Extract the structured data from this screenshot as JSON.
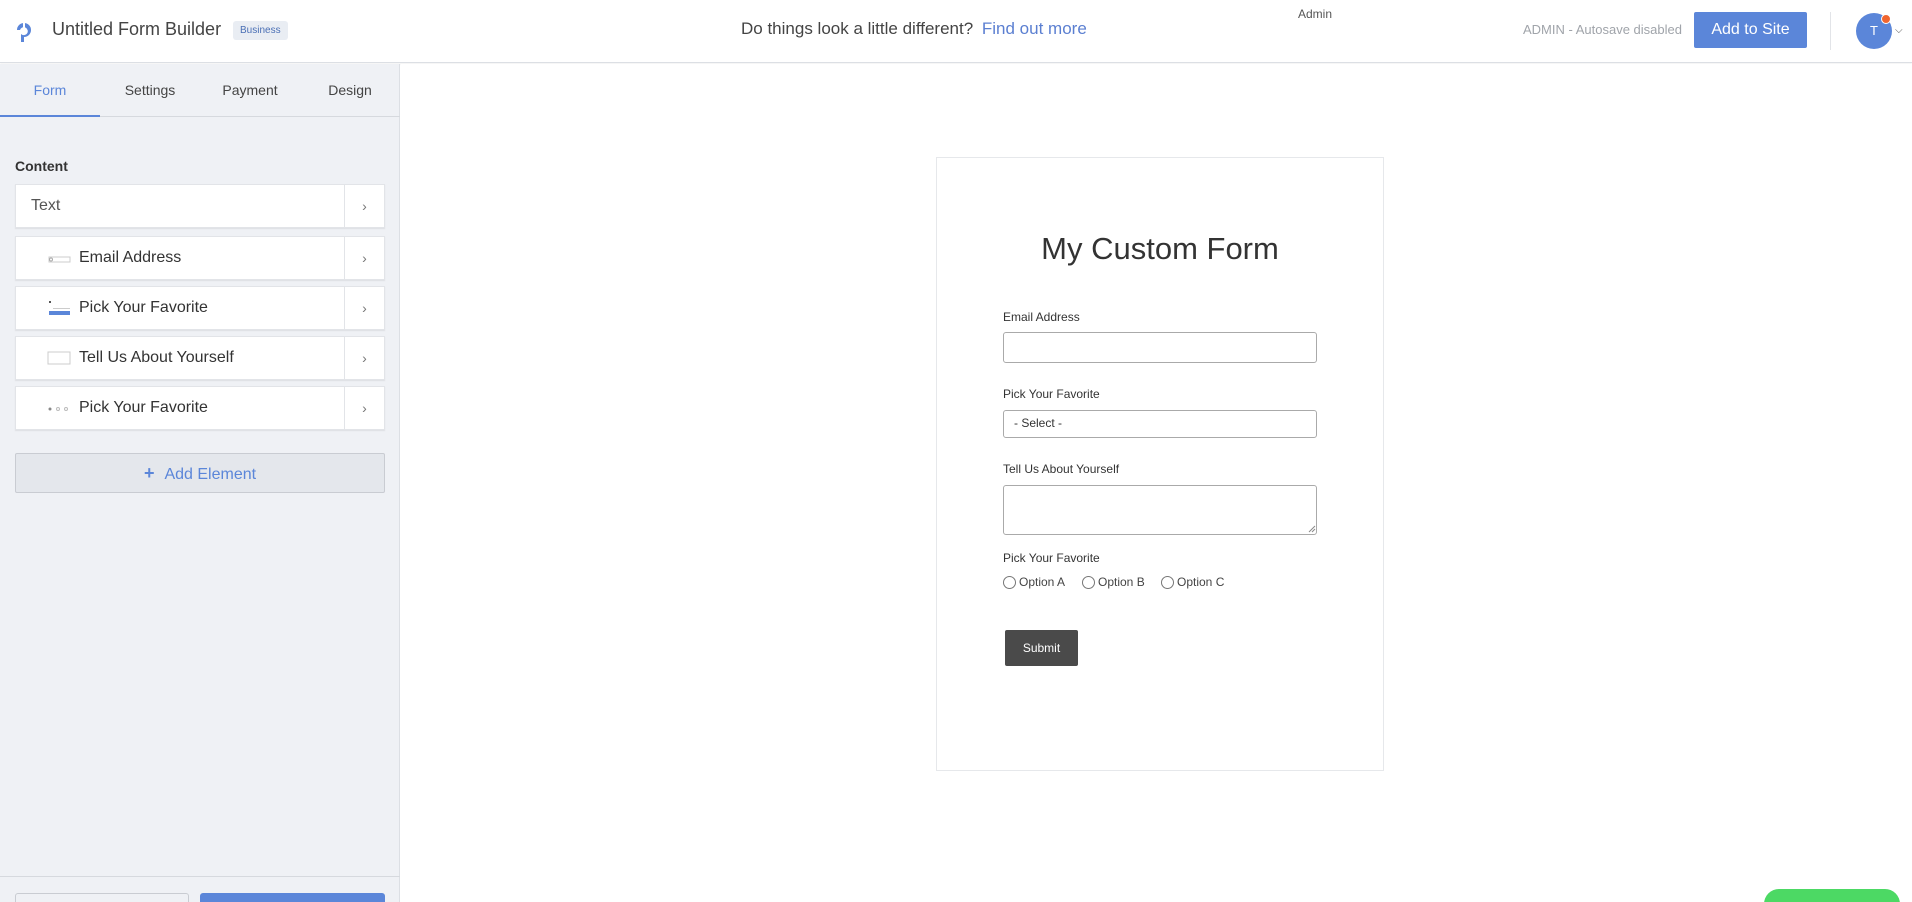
{
  "header": {
    "app_title": "Untitled Form Builder",
    "plan_badge": "Business",
    "notice_text": "Do things look a little different?",
    "notice_link": "Find out more",
    "admin_label": "Admin",
    "autosave_status": "ADMIN - Autosave disabled",
    "add_to_site_label": "Add to Site",
    "avatar_initial": "T"
  },
  "sidebar": {
    "tabs": [
      {
        "label": "Form",
        "active": true
      },
      {
        "label": "Settings",
        "active": false
      },
      {
        "label": "Payment",
        "active": false
      },
      {
        "label": "Design",
        "active": false
      }
    ],
    "content_heading": "Content",
    "elements": [
      {
        "label": "Text",
        "icon": "none"
      },
      {
        "label": "Email Address",
        "icon": "text-input-icon"
      },
      {
        "label": "Pick Your Favorite",
        "icon": "dropdown-icon"
      },
      {
        "label": "Tell Us About Yourself",
        "icon": "textarea-icon"
      },
      {
        "label": "Pick Your Favorite",
        "icon": "radio-group-icon"
      }
    ],
    "add_element_label": "Add Element"
  },
  "form": {
    "title": "My Custom Form",
    "email_label": "Email Address",
    "email_value": "",
    "select_label": "Pick Your Favorite",
    "select_value": "- Select -",
    "textarea_label": "Tell Us About Yourself",
    "textarea_value": "",
    "radio_label": "Pick Your Favorite",
    "radio_options": [
      "Option A",
      "Option B",
      "Option C"
    ],
    "submit_label": "Submit"
  },
  "colors": {
    "accent": "#5b86d9",
    "notification_dot": "#f0652f",
    "submit_bg": "#4a4a4a",
    "chat_green": "#4cd964"
  }
}
